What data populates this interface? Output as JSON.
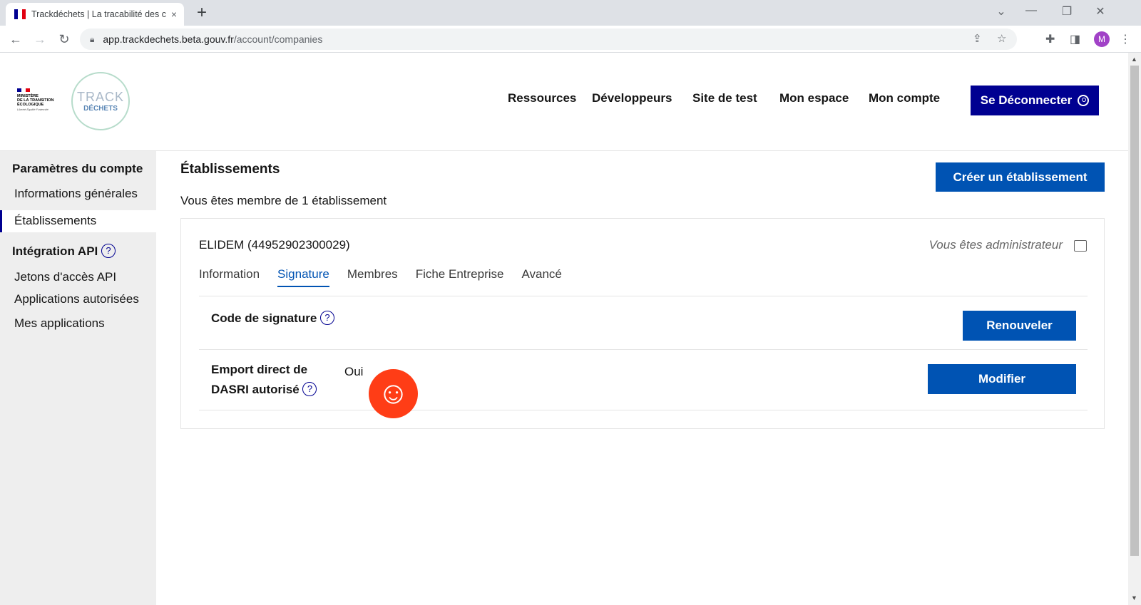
{
  "browser": {
    "tab_title": "Trackdéchets | La tracabilité des c",
    "tab_close": "×",
    "new_tab": "+",
    "url_host": "app.trackdechets.beta.gouv.fr",
    "url_path": "/account/companies",
    "profile_initial": "M"
  },
  "site": {
    "nav": [
      "Ressources",
      "Développeurs",
      "Site de test",
      "Mon espace",
      "Mon compte"
    ],
    "logout_label": "Se Déconnecter",
    "logo_line1": "TRACK",
    "logo_line2": "DÉCHETS",
    "ministry_lines": [
      "MINISTÈRE",
      "DE LA TRANSITION",
      "ÉCOLOGIQUE"
    ],
    "ministry_devise": "Liberté Égalité Fraternité"
  },
  "sidebar": {
    "section1_title": "Paramètres du compte",
    "section1_items": [
      "Informations générales",
      "Établissements"
    ],
    "section2_title": "Intégration API",
    "section2_items": [
      "Jetons d'accès API",
      "Applications autorisées",
      "Mes applications"
    ]
  },
  "main": {
    "title": "Établissements",
    "create_button": "Créer un établissement",
    "member_text": "Vous êtes membre de 1 établissement",
    "company": {
      "name": "ELIDEM (44952902300029)",
      "role": "Vous êtes administrateur",
      "tabs": [
        "Information",
        "Signature",
        "Membres",
        "Fiche Entreprise",
        "Avancé"
      ],
      "active_tab": "Signature",
      "signature_label": "Code de signature",
      "renew_button": "Renouveler",
      "dasri_label_line1": "Emport direct de",
      "dasri_label_line2": "DASRI autorisé",
      "dasri_value": "Oui",
      "modify_button": "Modifier"
    }
  },
  "help_glyph": "?",
  "smiley_glyph": "☺",
  "colors": {
    "primary_dark": "#000091",
    "primary": "#0053b3",
    "sidebar_bg": "#eeeeee",
    "smiley": "#ff3d16"
  }
}
